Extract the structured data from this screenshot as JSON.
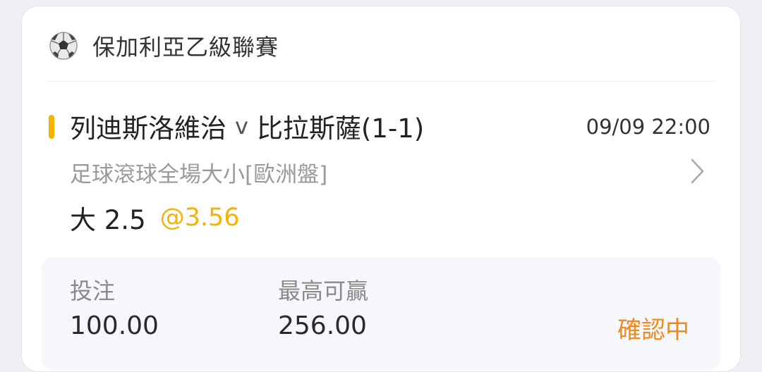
{
  "league": {
    "icon": "soccer-ball-icon",
    "name": "保加利亞乙級聯賽"
  },
  "match": {
    "home": "列迪斯洛維治",
    "vs": "v",
    "away": "比拉斯薩(1-1)",
    "datetime": "09/09 22:00"
  },
  "bet": {
    "sport": "足球",
    "mode": "滾球",
    "market": "全場大小",
    "odds_type": "[歐洲盤]",
    "selection": "大 2.5",
    "odds": "@3.56"
  },
  "summary": {
    "stake_label": "投注",
    "stake_value": "100.00",
    "max_win_label": "最高可贏",
    "max_win_value": "256.00",
    "status": "確認中"
  },
  "colors": {
    "accent": "#f5b301",
    "status": "#f08a1c"
  }
}
